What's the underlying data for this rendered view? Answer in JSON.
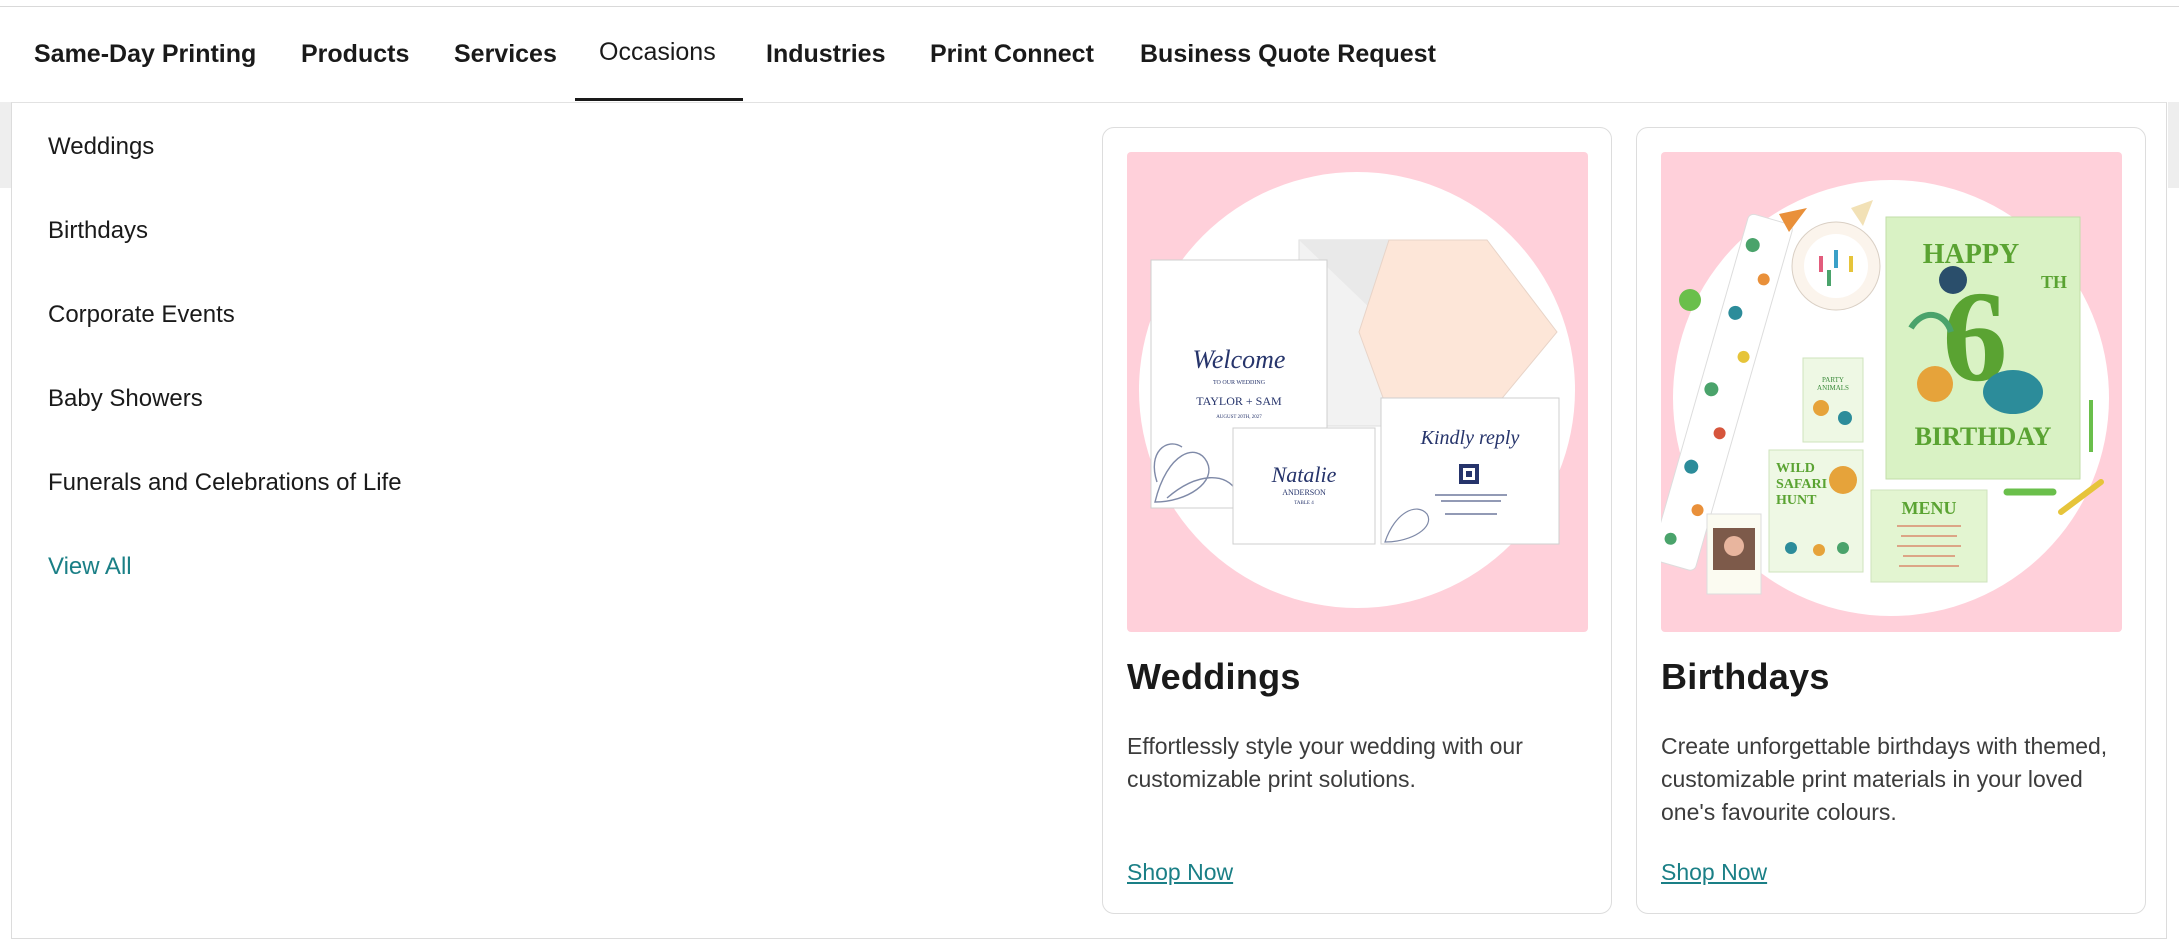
{
  "nav": {
    "tabs": [
      {
        "label": "Same-Day Printing",
        "active": false
      },
      {
        "label": "Products",
        "active": false
      },
      {
        "label": "Services",
        "active": false
      },
      {
        "label": "Occasions",
        "active": true
      },
      {
        "label": "Industries",
        "active": false
      },
      {
        "label": "Print Connect",
        "active": false
      },
      {
        "label": "Business Quote Request",
        "active": false
      }
    ]
  },
  "menu": {
    "items": [
      "Weddings",
      "Birthdays",
      "Corporate Events",
      "Baby Showers",
      "Funerals and Celebrations of Life"
    ],
    "view_all": "View All"
  },
  "cards": [
    {
      "title": "Weddings",
      "description": "Effortlessly style your wedding with our customizable print solutions.",
      "link": "Shop Now",
      "image_text": {
        "welcome": "Welcome",
        "to_our_wedding": "TO OUR WEDDING",
        "names": "TAYLOR + SAM",
        "date": "AUGUST 20TH, 2027",
        "place_name": "Natalie",
        "place_surname": "ANDERSON",
        "place_table": "TABLE 4",
        "reply": "Kindly reply"
      }
    },
    {
      "title": "Birthdays",
      "description": "Create unforgettable birthdays with themed, customizable print materials in your loved one's favourite colours.",
      "link": "Shop Now",
      "image_text": {
        "happy": "HAPPY",
        "number": "6",
        "th": "TH",
        "birthday": "BIRTHDAY",
        "menu": "MENU",
        "wild": "WILD",
        "safari": "SAFARI",
        "hunt": "HUNT",
        "party": "PARTY",
        "animals": "ANIMALS"
      }
    }
  ],
  "colors": {
    "accent_link": "#1a7f86",
    "card_image_bg": "#ffd0da",
    "text_primary": "#1a1a1a"
  }
}
